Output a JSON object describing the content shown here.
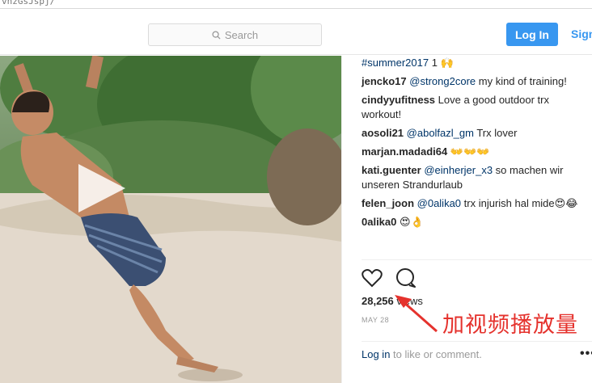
{
  "url_fragment": "vnzGsJspj/",
  "header": {
    "search_placeholder": "Search",
    "login_label": "Log In",
    "signup_label": "Sign"
  },
  "comments": [
    {
      "user": "",
      "mention": "#summer2017",
      "text": " 1"
    },
    {
      "user": "jencko17",
      "mention": "@strong2core",
      "text": " my kind of training!"
    },
    {
      "user": "cindyyufitness",
      "mention": "",
      "text": " Love a good outdoor trx workout!"
    },
    {
      "user": "aosoli21",
      "mention": "@abolfazl_gm",
      "text": " Trx lover"
    },
    {
      "user": "marjan.madadi64",
      "mention": "",
      "text": " 👐👐👐"
    },
    {
      "user": "kati.guenter",
      "mention": "@einherjer_x3",
      "text": " so machen wir unseren Strandurlaub"
    },
    {
      "user": "felen_joon",
      "mention": "@0alika0",
      "text": " trx injurish hal mide😍😂"
    },
    {
      "user": "0alika0",
      "mention": "",
      "text": " 😍👌"
    }
  ],
  "stats": {
    "views_count": "28,256",
    "views_label": " views",
    "date": "MAY 28"
  },
  "footer": {
    "login_link": "Log in",
    "rest": " to like or comment."
  },
  "annotation": {
    "text": "加视频播放量",
    "color": "#e5322d"
  },
  "colors": {
    "accent": "#3897f0",
    "link": "#003569"
  }
}
